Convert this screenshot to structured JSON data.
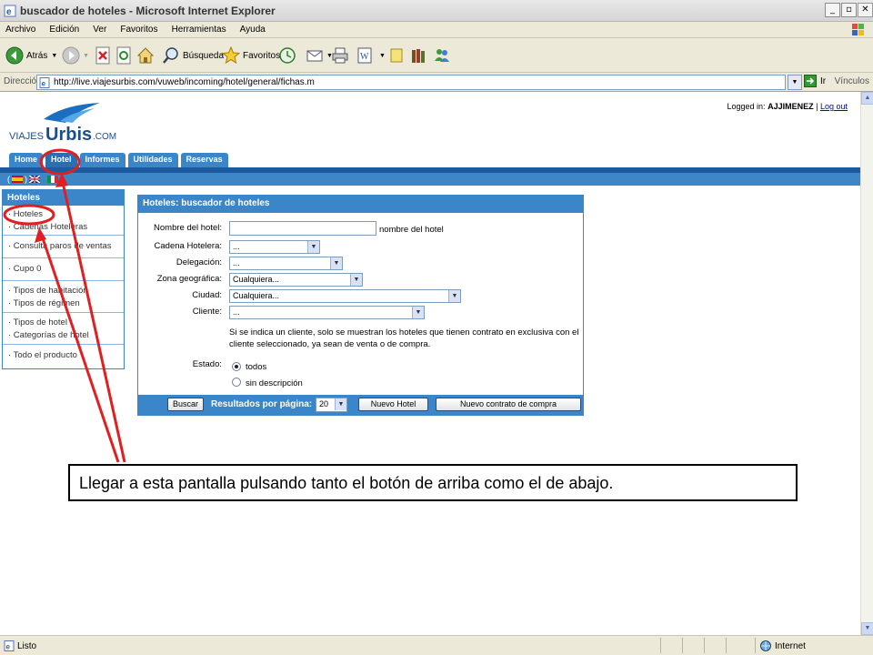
{
  "window": {
    "title": "buscador de hoteles - Microsoft Internet Explorer"
  },
  "menu": [
    "Archivo",
    "Edición",
    "Ver",
    "Favoritos",
    "Herramientas",
    "Ayuda"
  ],
  "toolbar": {
    "back": "Atrás",
    "search": "Búsqueda",
    "favorites": "Favoritos"
  },
  "address": {
    "label": "Dirección",
    "url": "http://live.viajesurbis.com/vuweb/incoming/hotel/general/fichas.m",
    "go": "Ir",
    "links": "Vínculos"
  },
  "site": {
    "logo": "VIAJES Urbis.COM",
    "logged_label": "Logged in:",
    "user": "AJJIMENEZ",
    "separator": "|",
    "logout": "Log out",
    "tabs": [
      "Home",
      "Hotel",
      "Informes",
      "Utilidades",
      "Reservas"
    ],
    "active_tab": "Hotel",
    "flags_prefix": "(",
    "flags_mid": ")"
  },
  "sidebar": {
    "title": "Hoteles",
    "groups": [
      [
        "· Hoteles",
        "· Cadenas Hoteleras"
      ],
      [
        "· Consulta paros de ventas"
      ],
      [
        "· Cupo 0"
      ],
      [
        "· Tipos de habitación",
        "· Tipos de régimen"
      ],
      [
        "· Tipos de hotel",
        "· Categorías de hotel"
      ],
      [
        "· Todo el producto"
      ]
    ]
  },
  "form": {
    "title": "Hoteles: buscador de hoteles",
    "hotel_name_label": "Nombre del hotel:",
    "hotel_name_value": "",
    "hotel_name_hint": "nombre del hotel",
    "chain_label": "Cadena Hotelera:",
    "chain_value": "...",
    "delegation_label": "Delegación:",
    "delegation_value": "...",
    "zone_label": "Zona geográfica:",
    "zone_value": "Cualquiera...",
    "city_label": "Ciudad:",
    "city_value": "Cualquiera...",
    "client_label": "Cliente:",
    "client_value": "...",
    "client_note": "Si se indica un cliente, solo se muestran los hoteles que tienen contrato en exclusiva con el cliente seleccionado, ya sean de venta o de compra.",
    "status_label": "Estado:",
    "status_options": [
      "todos",
      "sin descripción"
    ],
    "status_selected": "todos",
    "search_button": "Buscar",
    "results_label": "Resultados por página:",
    "results_value": "20",
    "new_hotel_button": "Nuevo Hotel",
    "new_contract_button": "Nuevo contrato de compra"
  },
  "annotation": {
    "note": "Llegar a esta pantalla pulsando tanto el botón de arriba como el de abajo.",
    "color": "#e02020"
  },
  "status": {
    "left": "Listo",
    "zone": "Internet"
  }
}
